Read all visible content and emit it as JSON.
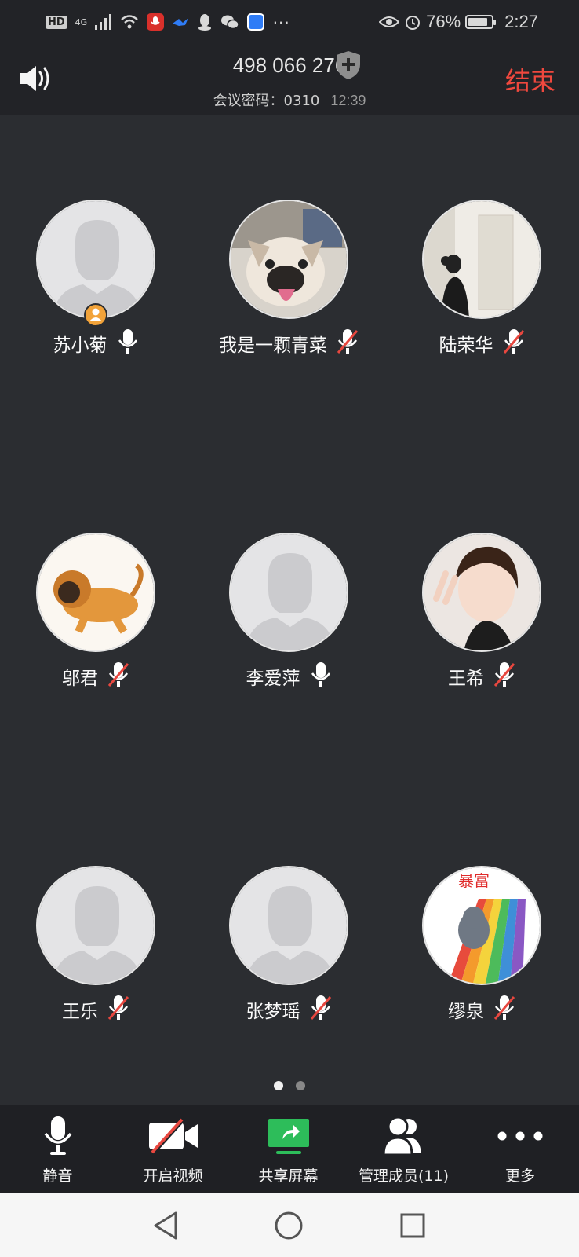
{
  "status_bar": {
    "hd_badge": "HD",
    "network": "4G",
    "battery": "76%",
    "time": "2:27",
    "more": "···"
  },
  "header": {
    "meeting_id": "498 066 276",
    "password_label": "会议密码：0310",
    "elapsed": "12:39",
    "end_button": "结束",
    "speaker_icon": "speaker-icon",
    "shield_icon": "shield-plus-icon"
  },
  "participants": [
    {
      "name": "苏小菊",
      "muted": false,
      "host": true,
      "avatar": "default"
    },
    {
      "name": "我是一颗青菜",
      "muted": true,
      "host": false,
      "avatar": "dog-photo"
    },
    {
      "name": "陆荣华",
      "muted": true,
      "host": false,
      "avatar": "woman-photo"
    },
    {
      "name": "邬君",
      "muted": true,
      "host": false,
      "avatar": "lion-drawing"
    },
    {
      "name": "李爱萍",
      "muted": false,
      "host": false,
      "avatar": "default"
    },
    {
      "name": "王希",
      "muted": true,
      "host": false,
      "avatar": "selfie-photo"
    },
    {
      "name": "王乐",
      "muted": true,
      "host": false,
      "avatar": "default"
    },
    {
      "name": "张梦瑶",
      "muted": true,
      "host": false,
      "avatar": "default"
    },
    {
      "name": "缪泉",
      "muted": true,
      "host": false,
      "avatar": "cartoon-rainbow"
    }
  ],
  "pagination": {
    "pages": 2,
    "current": 1
  },
  "toolbar": {
    "mute": "静音",
    "video": "开启视频",
    "share": "共享屏幕",
    "members": "管理成员(11)",
    "more": "更多"
  },
  "colors": {
    "background": "#2b2d31",
    "header": "#222327",
    "end": "#f0483e",
    "mute_slash": "#e8473f",
    "share_green": "#2dbd5a",
    "host_badge": "#f2a33a"
  }
}
